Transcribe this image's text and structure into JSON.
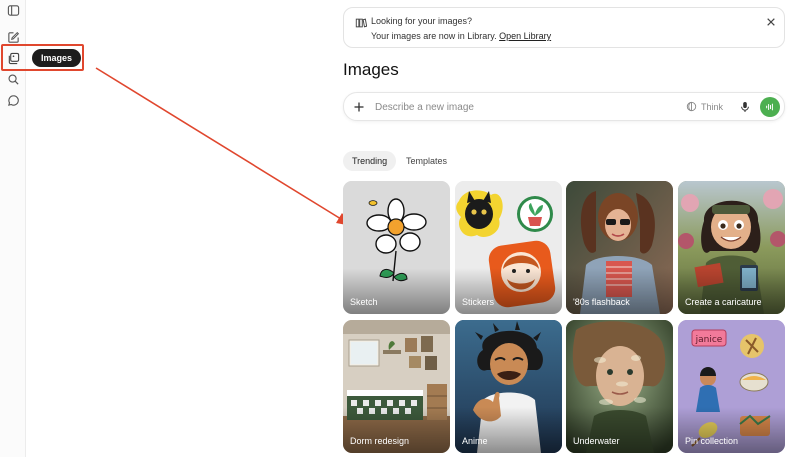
{
  "sidebar": {
    "tooltip": "Images"
  },
  "notice": {
    "title": "Looking for your images?",
    "body": "Your images are now in Library.",
    "link": "Open Library"
  },
  "page": {
    "title": "Images"
  },
  "prompt": {
    "placeholder": "Describe a new image",
    "think_label": "Think"
  },
  "tabs": [
    {
      "label": "Trending",
      "active": true
    },
    {
      "label": "Templates",
      "active": false
    }
  ],
  "cards": [
    {
      "label": "Sketch"
    },
    {
      "label": "Stickers"
    },
    {
      "label": "'80s flashback"
    },
    {
      "label": "Create a caricature"
    },
    {
      "label": "Dorm redesign"
    },
    {
      "label": "Anime"
    },
    {
      "label": "Underwater"
    },
    {
      "label": "Pin collection"
    }
  ],
  "colors": {
    "annotation": "#e0472e",
    "voice_button": "#4caf50",
    "tooltip_bg": "#1d1d1d"
  }
}
